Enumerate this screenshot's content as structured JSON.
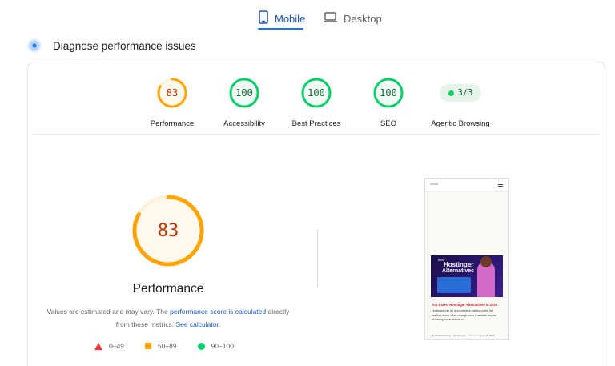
{
  "tabs": [
    {
      "label": "Mobile",
      "icon": "smartphone-icon",
      "active": true
    },
    {
      "label": "Desktop",
      "icon": "laptop-icon",
      "active": false
    }
  ],
  "diagnose": {
    "title": "Diagnose performance issues",
    "icon": "diagnose-icon"
  },
  "gauges": [
    {
      "label": "Performance",
      "value": "83",
      "score": 83,
      "status": "average"
    },
    {
      "label": "Accessibility",
      "value": "100",
      "score": 100,
      "status": "pass"
    },
    {
      "label": "Best Practices",
      "value": "100",
      "score": 100,
      "status": "pass"
    },
    {
      "label": "SEO",
      "value": "100",
      "score": 100,
      "status": "pass"
    },
    {
      "label": "Agentic Browsing",
      "value": "3/3",
      "status": "pass"
    }
  ],
  "main": {
    "score": "83",
    "score_fraction": 0.83,
    "title": "Performance",
    "note_prefix": "Values are estimated and may vary. The ",
    "note_link": "performance score is calculated",
    "note_mid": " directly from these metrics. ",
    "note_link2": "See calculator.",
    "legend": [
      {
        "range": "0–49",
        "shape": "triangle",
        "color": "#ff3333"
      },
      {
        "range": "50–89",
        "shape": "square",
        "color": "#ffa400"
      },
      {
        "range": "90–100",
        "shape": "circle",
        "color": "#0cce6b"
      }
    ]
  },
  "preview": {
    "logo": "Merab",
    "banner_line1": "Best",
    "banner_line2": "Hostinger",
    "banner_line3": "Alternatives",
    "article_title": "Top 5 Best Hostinger Alternatives in 2025",
    "article_text": "Hostinger can be a convenient starting point, but hosting needs often change once a website begins receiving more visitors or...",
    "article_meta": "By Shahid Farooq · 18 min read · updated August 18, 2025"
  },
  "colors": {
    "average": "#ffa400",
    "pass": "#0cce6b",
    "accent": "#1a73e8"
  }
}
